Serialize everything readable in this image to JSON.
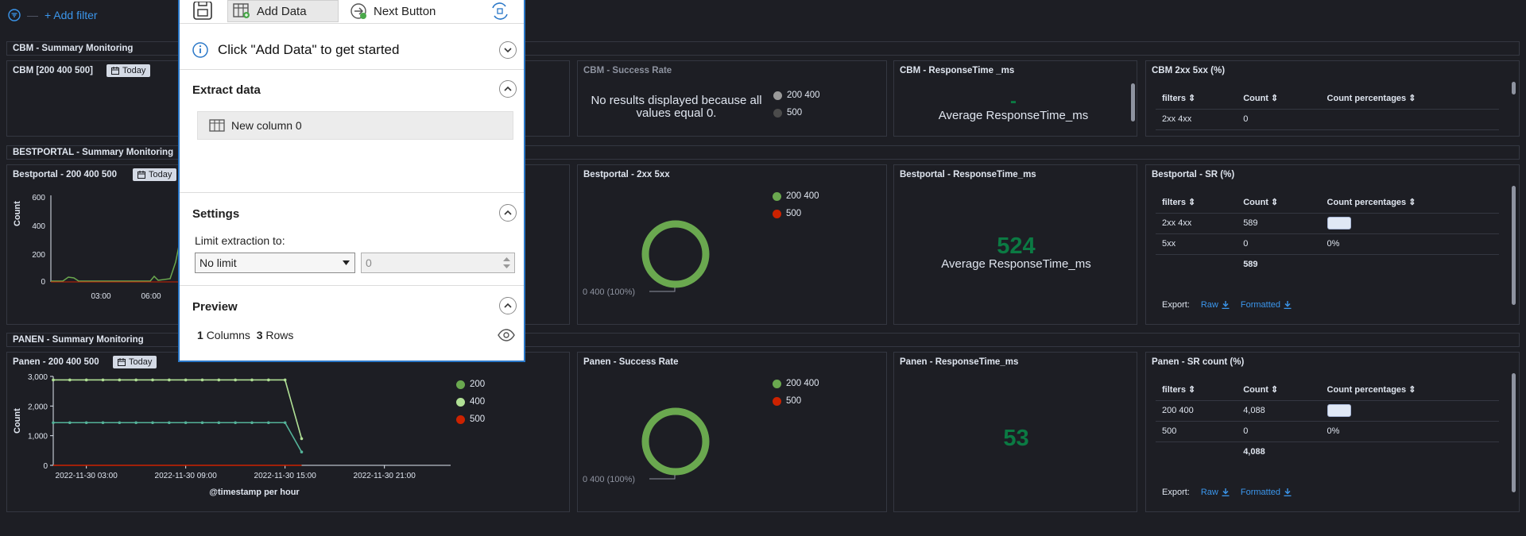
{
  "filter": {
    "add_label": "+ Add filter"
  },
  "sections": [
    {
      "title": "CBM - Summary Monitoring"
    },
    {
      "title": "BESTPORTAL - Summary Monitoring"
    },
    {
      "title": "PANEN - Summary Monitoring"
    }
  ],
  "cbm": {
    "volume_title": "CBM [200 400 500]",
    "today_label": "Today",
    "success_title": "CBM - Success Rate",
    "success_message": "No results displayed because all values equal 0.",
    "success_legend": [
      "200 400",
      "500"
    ],
    "resp_title": "CBM - ResponseTime _ms",
    "resp_value": "-",
    "resp_label": "Average ResponseTime_ms",
    "table_title": "CBM 2xx 5xx (%)",
    "table_headers": [
      "filters",
      "Count",
      "Count percentages"
    ],
    "table_rows": [
      [
        "2xx 4xx",
        "0",
        ""
      ]
    ]
  },
  "bestportal": {
    "volume_title": "Bestportal - 200 400 500",
    "today_label": "Today",
    "y_axis_label": "Count",
    "y_ticks": [
      "600",
      "400",
      "200",
      "0"
    ],
    "x_ticks": [
      "03:00",
      "06:00"
    ],
    "donut_title": "Bestportal - 2xx 5xx",
    "donut_legend": [
      "200 400",
      "500"
    ],
    "donut_callout": "0 400 (100%)",
    "resp_title": "Bestportal - ResponseTime_ms",
    "resp_value": "524",
    "resp_label": "Average ResponseTime_ms",
    "table_title": "Bestportal - SR (%)",
    "table_headers": [
      "filters",
      "Count",
      "Count percentages"
    ],
    "table_rows": [
      [
        "2xx 4xx",
        "589",
        ""
      ],
      [
        "5xx",
        "0",
        "0%"
      ]
    ],
    "table_total": "589",
    "export_label": "Export:",
    "export_raw": "Raw",
    "export_formatted": "Formatted"
  },
  "panen": {
    "volume_title": "Panen - 200 400 500",
    "today_label": "Today",
    "y_axis_label": "Count",
    "x_axis_label": "@timestamp per hour",
    "legend": [
      "200",
      "400",
      "500"
    ],
    "donut_title": "Panen - Success Rate",
    "donut_legend": [
      "200 400",
      "500"
    ],
    "donut_callout": "0 400 (100%)",
    "resp_title": "Panen - ResponseTime_ms",
    "resp_value": "53",
    "table_title": "Panen - SR count (%)",
    "table_headers": [
      "filters",
      "Count",
      "Count percentages"
    ],
    "table_rows": [
      [
        "200 400",
        "4,088",
        ""
      ],
      [
        "500",
        "0",
        "0%"
      ]
    ],
    "table_total": "4,088",
    "export_label": "Export:",
    "export_raw": "Raw",
    "export_formatted": "Formatted"
  },
  "chart_data": {
    "type": "line",
    "title": "Panen - 200 400 500",
    "xlabel": "@timestamp per hour",
    "ylabel": "Count",
    "x_tick_labels": [
      "2022-11-30 03:00",
      "2022-11-30 09:00",
      "2022-11-30 15:00",
      "2022-11-30 21:00"
    ],
    "y_tick_labels": [
      "3,000",
      "2,000",
      "1,000",
      "0"
    ],
    "ylim": [
      0,
      3000
    ],
    "xlim_hours": [
      0,
      24
    ],
    "grid": false,
    "legend_position": "right",
    "x_hours": [
      0,
      1,
      2,
      3,
      4,
      5,
      6,
      7,
      8,
      9,
      10,
      11,
      12,
      13,
      14,
      15
    ],
    "series": [
      {
        "name": "200",
        "color": "#54b399",
        "values": [
          1440,
          1440,
          1440,
          1440,
          1440,
          1440,
          1440,
          1440,
          1440,
          1440,
          1440,
          1440,
          1440,
          1440,
          1440,
          450
        ]
      },
      {
        "name": "400",
        "color": "#b0e095",
        "values": [
          2880,
          2880,
          2880,
          2880,
          2880,
          2880,
          2880,
          2880,
          2880,
          2880,
          2880,
          2880,
          2880,
          2880,
          2880,
          900
        ]
      },
      {
        "name": "500",
        "color": "#cc2200",
        "values": [
          0,
          0,
          0,
          0,
          0,
          0,
          0,
          0,
          0,
          0,
          0,
          0,
          0,
          0,
          0,
          0
        ]
      }
    ]
  },
  "colors": {
    "accent": "#3b96ec",
    "good": "#6aa84f",
    "bad": "#cc2200",
    "metric": "#0b7a43"
  },
  "overlay": {
    "toolbar_add_data": "Add Data",
    "toolbar_next_button": "Next Button",
    "info_text": "Click \"Add Data\" to get started",
    "extract_heading": "Extract data",
    "column_item": "New column 0",
    "settings_heading": "Settings",
    "limit_label": "Limit extraction to:",
    "limit_select": "No limit",
    "limit_number": "0",
    "preview_heading": "Preview",
    "preview_columns_count": "1",
    "preview_columns_label": "Columns",
    "preview_rows_count": "3",
    "preview_rows_label": "Rows"
  }
}
